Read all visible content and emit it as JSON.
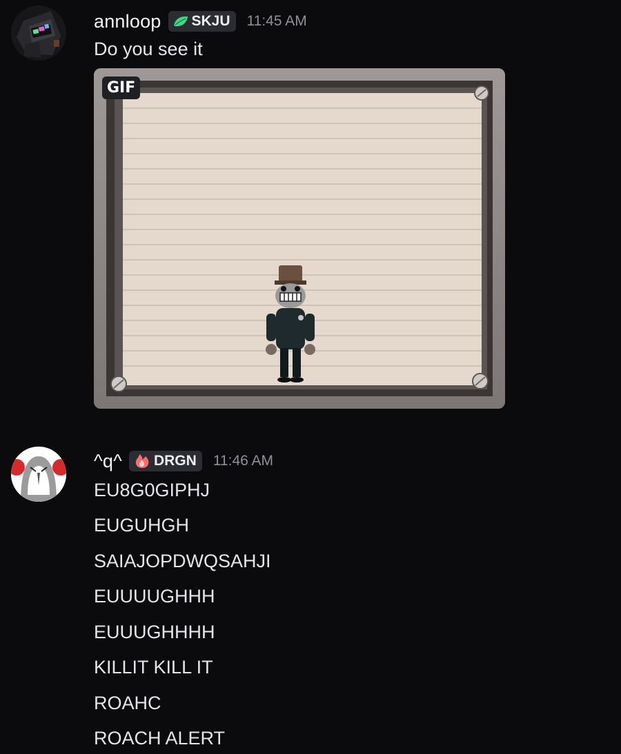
{
  "messages": [
    {
      "username": "annloop",
      "tag": "SKJU",
      "tag_icon": "leaf-icon",
      "tag_color": "#3ddc84",
      "timestamp": "11:45 AM",
      "text": "Do you see it",
      "attachment": {
        "type": "gif",
        "badge": "GIF"
      }
    },
    {
      "username": "^q^",
      "tag": "DRGN",
      "tag_icon": "flame-icon",
      "tag_color": "#ff6b6b",
      "timestamp": "11:46 AM",
      "lines": [
        "EU8G0GIPHJ",
        "EUGUHGH",
        "SAIAJOPDWQSAHJI",
        "EUUUUGHHH",
        "EUUUGHHHH",
        "KILLIT KILL IT",
        "ROAHC",
        "ROACH ALERT"
      ]
    }
  ],
  "colors": {
    "background": "#0b0b0e",
    "username": "#f2f3f5",
    "timestamp": "#8e9097",
    "tag_bg": "#2c2d32"
  }
}
